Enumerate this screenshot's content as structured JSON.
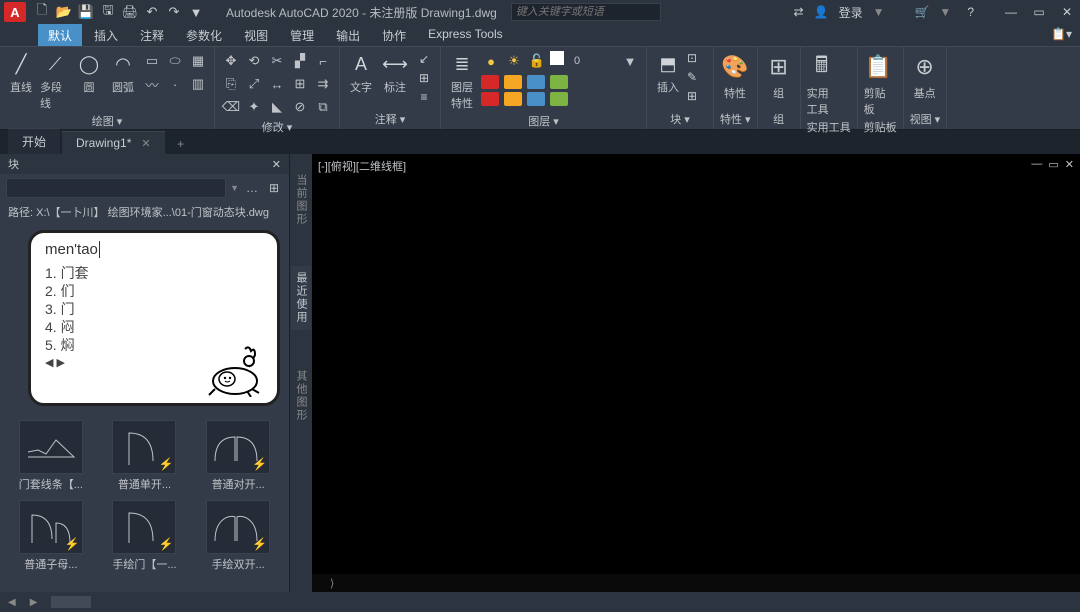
{
  "titlebar": {
    "logo": "A",
    "title": "Autodesk AutoCAD 2020 - 未注册版    Drawing1.dwg",
    "search_placeholder": "键入关键字或短语",
    "login": "登录",
    "share_icon": "⇄"
  },
  "ribtabs": [
    "默认",
    "插入",
    "注释",
    "参数化",
    "视图",
    "管理",
    "输出",
    "协作",
    "Express Tools"
  ],
  "ribbon": {
    "draw": {
      "label": "绘图 ▾",
      "line": "直线",
      "pline": "多段线",
      "circle": "圆",
      "arc": "圆弧"
    },
    "modify": {
      "label": "修改 ▾"
    },
    "annotate": {
      "label": "注释 ▾",
      "text": "文字",
      "dim": "标注"
    },
    "layer": {
      "label": "图层 ▾",
      "props": "图层\n特性"
    },
    "block": {
      "label": "块 ▾",
      "insert": "插入"
    },
    "props": {
      "label": "特性 ▾",
      "btn": "特性"
    },
    "group": {
      "label": "组",
      "btn": "组"
    },
    "util": {
      "label": "实用工具",
      "btn": "实用工具"
    },
    "clip": {
      "label": "剪贴板",
      "btn": "剪贴板"
    },
    "base": {
      "label": "基点",
      "btn": "基点"
    },
    "view": {
      "label": "视图 ▾"
    }
  },
  "filetabs": {
    "start": "开始",
    "doc": "Drawing1*"
  },
  "palette": {
    "title": "块",
    "path": "路径: X:\\【一卜川】 绘图环境家...\\01-门窗动态块.dwg",
    "vtabs": [
      "当前图形",
      "最近使用",
      "其他图形"
    ],
    "thumbs": [
      {
        "cap": "门套线条【..."
      },
      {
        "cap": "普通单开...",
        "bolt": true
      },
      {
        "cap": "普通对开...",
        "bolt": true
      },
      {
        "cap": "普通子母...",
        "bolt": true
      },
      {
        "cap": "手绘门【一...",
        "bolt": true
      },
      {
        "cap": "手绘双开...",
        "bolt": true
      }
    ]
  },
  "ime": {
    "typed": "men'tao",
    "cands": [
      "1. 门套",
      "2. 们",
      "3. 门",
      "4. 闷",
      "5. 焖"
    ],
    "arrows": "◀ ▶"
  },
  "viewport": {
    "label": "[-][俯视][二维线框]"
  },
  "cmd": "⟩"
}
